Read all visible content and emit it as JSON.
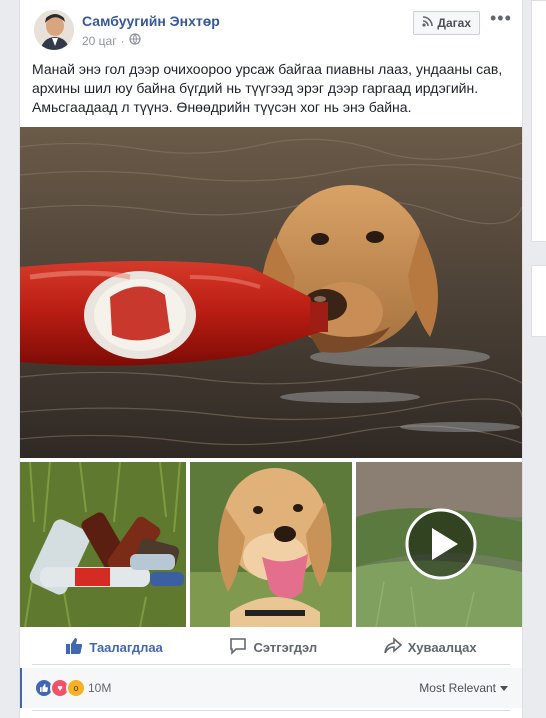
{
  "post": {
    "author": "Самбуугийн Энхтөр",
    "time": "20 цаг",
    "follow_label": "Дагах",
    "more_label": "•••",
    "text": "Манай энэ гол дээр очихоороо урсаж байгаа пиавны лааз, ундааны сав, архины шил юу байна бүгдий нь түүгээд эрэг дээр гаргаад ирдэгийн. Амьсгаадаад л түүнэ. Өнөөдрийн түүсэн хог нь энэ байна."
  },
  "actions": {
    "like": "Таалагдлаа",
    "comment": "Сэтгэгдэл",
    "share": "Хуваалцах"
  },
  "reactions": {
    "count": "10M",
    "sort_label": "Most Relevant"
  },
  "colors": {
    "link": "#365899",
    "like_blue": "#4267b2",
    "love_red": "#f25268",
    "wow_yellow": "#f7b125"
  }
}
